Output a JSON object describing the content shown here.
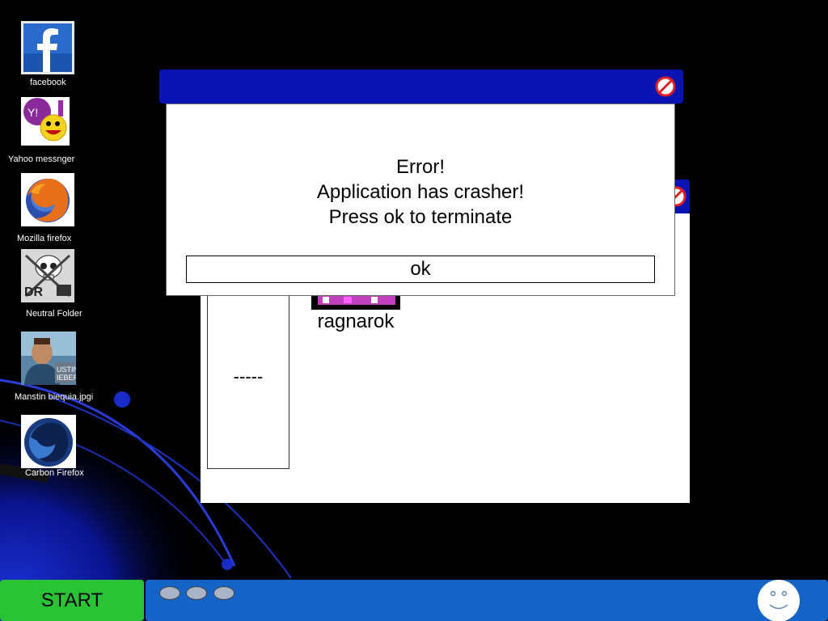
{
  "desktop": {
    "icons": [
      {
        "label": "facebook",
        "icon": "facebook-icon"
      },
      {
        "label": "Yahoo  messnger",
        "icon": "yahoo-messenger-icon"
      },
      {
        "label": "Mozilla firefox",
        "icon": "firefox-icon"
      },
      {
        "label": "Neutral Folder",
        "icon": "skull-folder-icon"
      },
      {
        "label": "Manstin biequia.jpgi",
        "icon": "photo-icon"
      },
      {
        "label": "Carbon Firefox",
        "icon": "carbon-firefox-icon"
      }
    ]
  },
  "back_window": {
    "side_panel_text": "-----",
    "item_label": "ragnarok"
  },
  "error_dialog": {
    "line1": "Error!",
    "line2": "Application has crasher!",
    "line3": "Press ok to terminate",
    "ok_label": "ok"
  },
  "taskbar": {
    "start_label": "START",
    "tray_icon": "smiley-face-icon"
  },
  "colors": {
    "titlebar": "#0a14b4",
    "start": "#2bc336",
    "taskbar": "#1464c8",
    "close": "#e02020"
  }
}
